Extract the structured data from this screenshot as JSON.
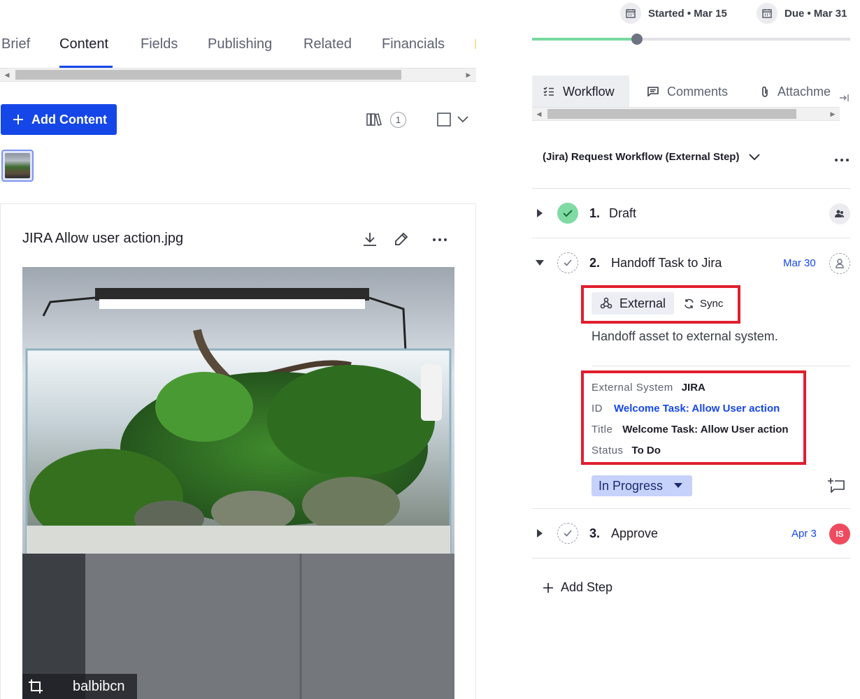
{
  "left_tabs": [
    {
      "label": "Brief",
      "active": false
    },
    {
      "label": "Content",
      "active": true
    },
    {
      "label": "Fields",
      "active": false
    },
    {
      "label": "Publishing",
      "active": false
    },
    {
      "label": "Related",
      "active": false
    },
    {
      "label": "Financials",
      "active": false
    }
  ],
  "content_toolbar": {
    "add_content_label": "Add Content",
    "library_count": "1",
    "icons": [
      "plus-icon",
      "library-icon",
      "checkbox-icon",
      "chevron-down-icon"
    ]
  },
  "asset": {
    "title": "JIRA Allow user action.jpg",
    "actions": [
      "download-icon",
      "edit-icon",
      "more-icon"
    ],
    "credit": "balbibcn"
  },
  "dates": {
    "started_label": "Started • Mar 15",
    "due_label": "Due • Mar 31"
  },
  "progress": {
    "fraction": 0.33
  },
  "right_tabs": [
    {
      "label": "Workflow",
      "active": true,
      "icon": "checklist-icon"
    },
    {
      "label": "Comments",
      "active": false,
      "icon": "comment-icon"
    },
    {
      "label": "Attachme",
      "active": false,
      "icon": "paperclip-icon"
    }
  ],
  "workflow": {
    "name": "(Jira) Request Workflow (External Step)",
    "steps": [
      {
        "num": "1.",
        "name": "Draft",
        "status": "done",
        "date": "",
        "avatar": "assignee-group-icon"
      },
      {
        "num": "2.",
        "name": "Handoff Task to Jira",
        "status": "pending",
        "date": "Mar 30",
        "avatar": "unassigned-user-icon",
        "badge_label": "External",
        "sync_label": "Sync",
        "description": "Handoff asset to external system.",
        "details": [
          {
            "key": "External System",
            "value": "JIRA",
            "link": false
          },
          {
            "key": "ID",
            "value": "Welcome Task: Allow User action",
            "link": true
          },
          {
            "key": "Title",
            "value": "Welcome Task: Allow User action",
            "link": false
          },
          {
            "key": "Status",
            "value": "To Do",
            "link": false
          }
        ],
        "state_label": "In Progress"
      },
      {
        "num": "3.",
        "name": "Approve",
        "status": "pending",
        "date": "Apr 3",
        "avatar_initials": "IS",
        "avatar_color": "#ef4b5f"
      }
    ],
    "add_step_label": "Add Step"
  },
  "colors": {
    "accent": "#1547e8",
    "done": "#7fdaa4",
    "highlight": "#e01f2f",
    "progress": "#79d9a0"
  }
}
